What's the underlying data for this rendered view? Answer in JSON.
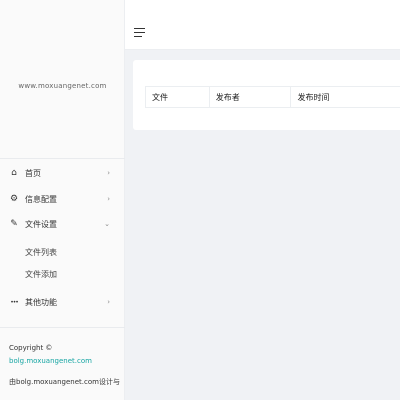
{
  "sidebar": {
    "site_url": "www.moxuangenet.com",
    "menu": [
      {
        "icon": "home-icon",
        "glyph": "⌂",
        "label": "首页",
        "arrow": "›"
      },
      {
        "icon": "gear-icon",
        "glyph": "⚙",
        "label": "信息配置",
        "arrow": "›"
      },
      {
        "icon": "pencil-icon",
        "glyph": "✎",
        "label": "文件设置",
        "arrow": "⌄"
      },
      {
        "icon": "more-icon",
        "glyph": "•••",
        "label": "其他功能",
        "arrow": "›"
      }
    ],
    "submenu": [
      {
        "label": "文件列表"
      },
      {
        "label": "文件添加"
      }
    ],
    "footer": {
      "copyright": "Copyright ©",
      "link": "bolg.moxuangenet.com",
      "credit": "由bolg.moxuangenet.com设计与"
    }
  },
  "table": {
    "columns": [
      "文件",
      "发布者",
      "发布时间"
    ]
  },
  "colors": {
    "link": "#16a5a3",
    "background": "#f0f2f5"
  }
}
